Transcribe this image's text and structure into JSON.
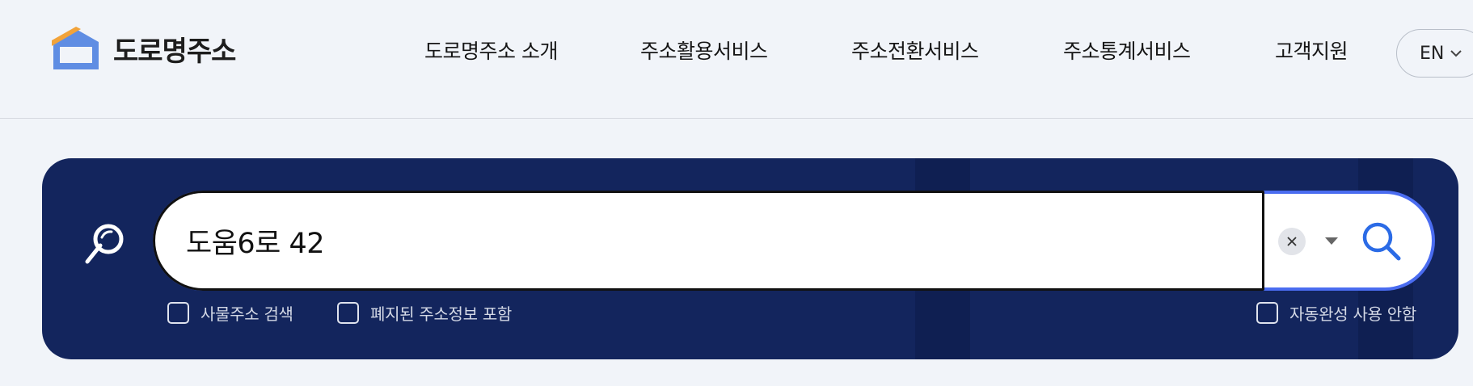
{
  "header": {
    "logo_text": "도로명주소",
    "nav": [
      {
        "label": "도로명주소 소개"
      },
      {
        "label": "주소활용서비스"
      },
      {
        "label": "주소전환서비스"
      },
      {
        "label": "주소통계서비스"
      },
      {
        "label": "고객지원"
      }
    ],
    "lang": "EN"
  },
  "search": {
    "value": "도움6로 42",
    "options": [
      {
        "label": "사물주소 검색",
        "checked": false
      },
      {
        "label": "폐지된 주소정보 포함",
        "checked": false
      },
      {
        "label": "자동완성 사용 안함",
        "checked": false
      }
    ]
  },
  "colors": {
    "panel_bg": "#13255d",
    "accent": "#2b6be6",
    "logo_orange": "#f2a33a",
    "logo_blue": "#5f8de3"
  },
  "icons": {
    "logo": "house-logo-icon",
    "panel": "magnifier-icon",
    "clear": "close-icon",
    "dropdown": "caret-down-icon",
    "submit": "search-icon",
    "lang": "chevron-down-icon"
  }
}
